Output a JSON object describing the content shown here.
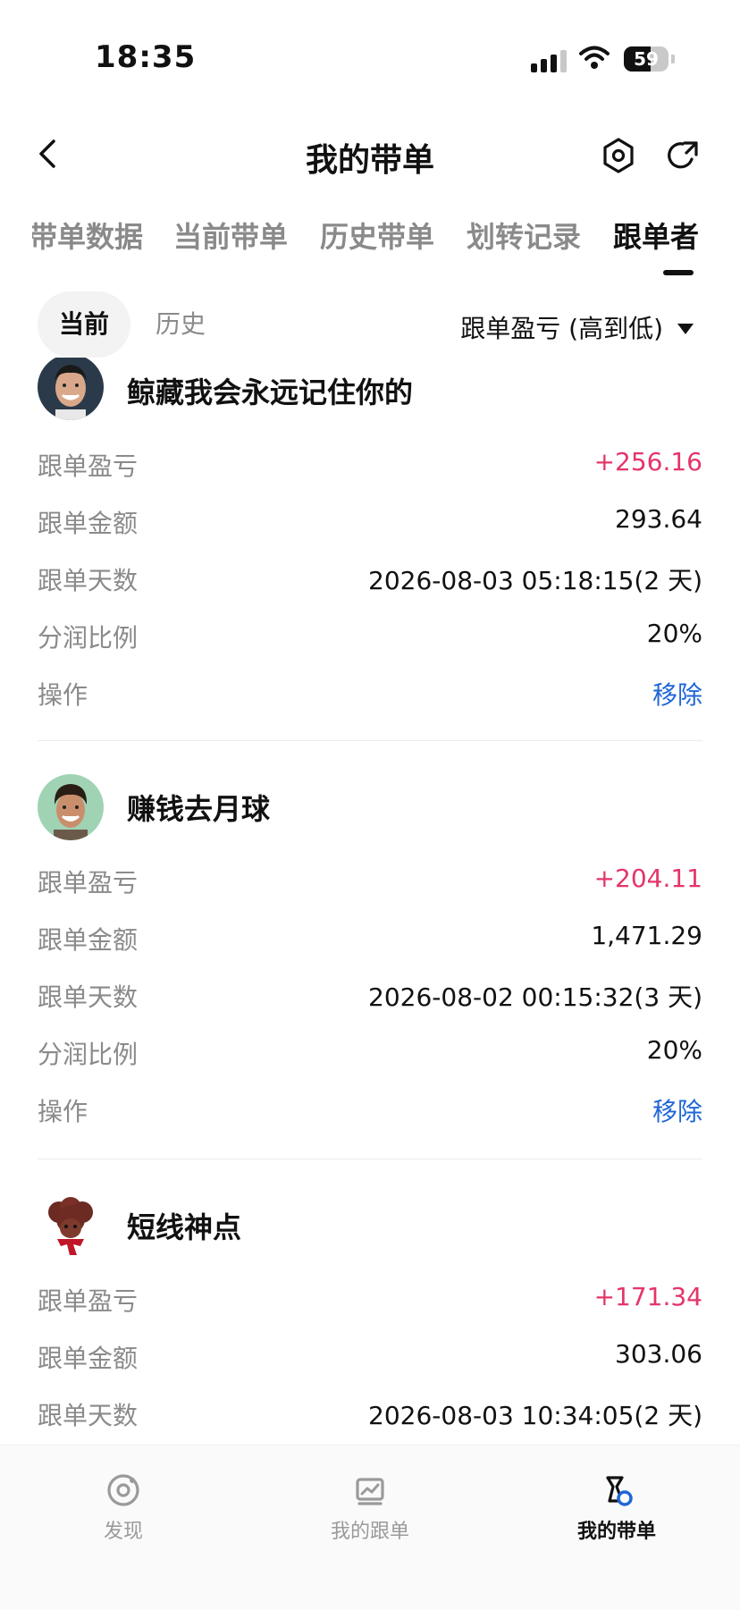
{
  "status_bar": {
    "time": "18:35",
    "battery": "59"
  },
  "nav": {
    "title": "我的带单"
  },
  "tabs": [
    {
      "label": "带单数据",
      "active": false
    },
    {
      "label": "当前带单",
      "active": false
    },
    {
      "label": "历史带单",
      "active": false
    },
    {
      "label": "划转记录",
      "active": false
    },
    {
      "label": "跟单者",
      "active": true
    }
  ],
  "filter": {
    "current_label": "当前",
    "history_label": "历史",
    "sort_label": "跟单盈亏 (高到低)"
  },
  "labels": {
    "pnl": "跟单盈亏",
    "amount": "跟单金额",
    "days": "跟单天数",
    "share": "分润比例",
    "action": "操作"
  },
  "followers": [
    {
      "name": "鲸藏我会永远记住你的",
      "pnl": "+256.16",
      "amount": "293.64",
      "days": "2026-08-03 05:18:15(2 天)",
      "share": "20%",
      "action": "移除"
    },
    {
      "name": "赚钱去月球",
      "pnl": "+204.11",
      "amount": "1,471.29",
      "days": "2026-08-02 00:15:32(3 天)",
      "share": "20%",
      "action": "移除"
    },
    {
      "name": "短线神点",
      "pnl": "+171.34",
      "amount": "303.06",
      "days": "2026-08-03 10:34:05(2 天)"
    }
  ],
  "bottom_nav": [
    {
      "label": "发现",
      "icon": "discover-icon",
      "active": false
    },
    {
      "label": "我的跟单",
      "icon": "chart-icon",
      "active": false
    },
    {
      "label": "我的带单",
      "icon": "lead-trade-icon",
      "active": true
    }
  ],
  "colors": {
    "positive": "#e4356a",
    "link": "#1f66d6",
    "muted": "#8a8a8a"
  }
}
